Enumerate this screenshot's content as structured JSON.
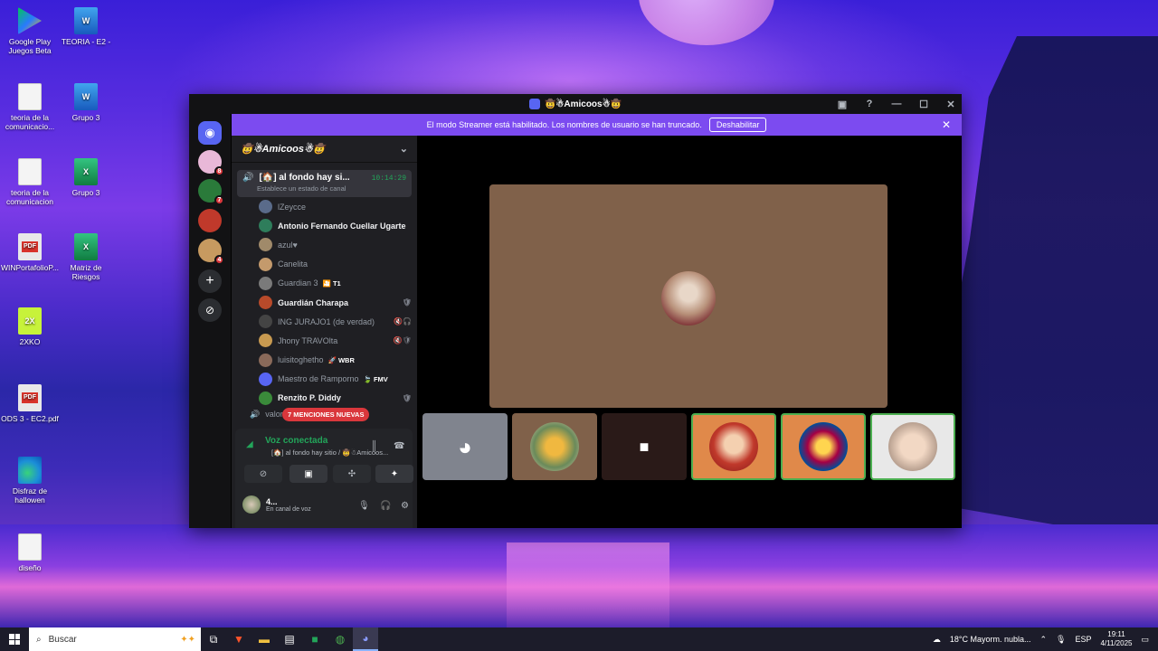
{
  "desktop": {
    "icons": [
      {
        "label": "Google Play Juegos Beta",
        "type": "play"
      },
      {
        "label": "TEORIA - E2 -",
        "type": "word"
      },
      {
        "label": "teoria de la comunicacio...",
        "type": "doc"
      },
      {
        "label": "Grupo 3",
        "type": "word"
      },
      {
        "label": "teoria de la comunicacion",
        "type": "doc"
      },
      {
        "label": "Grupo 3",
        "type": "excel"
      },
      {
        "label": "WINPortafolioP...",
        "type": "pdf"
      },
      {
        "label": "Matriz de Riesgos",
        "type": "excel"
      },
      {
        "label": "2XKO",
        "type": "2xko"
      },
      {
        "label": "ODS 3 - EC2.pdf",
        "type": "pdf"
      },
      {
        "label": "Disfraz de hallowen",
        "type": "edge"
      },
      {
        "label": "diseño",
        "type": "doc"
      }
    ]
  },
  "discord": {
    "window_title": "🤠☃Amicoos☃🤠",
    "banner_text": "El modo Streamer está habilitado. Los nombres de usuario se han truncado.",
    "banner_button": "Deshabilitar",
    "server_badges": [
      "8",
      "7",
      "",
      "4"
    ],
    "guild_name": "🤠☃Amicoos☃🤠",
    "voice_channel": {
      "name": "[🏠] al fondo hay si...",
      "time": "10:14:29",
      "status_placeholder": "Establece un estado de canal"
    },
    "members": [
      {
        "name": "lZeycce",
        "bright": false,
        "av": "#5a6b8a",
        "tag": "",
        "right": ""
      },
      {
        "name": "Antonio Fernando Cuellar Ugarte",
        "bright": true,
        "av": "#2e7d5b",
        "tag": "",
        "right": ""
      },
      {
        "name": "azul♥",
        "bright": false,
        "av": "#a08a6a",
        "tag": "",
        "right": ""
      },
      {
        "name": "Canelita",
        "bright": false,
        "av": "#c49a6c",
        "tag": "",
        "right": ""
      },
      {
        "name": "Guardian 3",
        "bright": false,
        "av": "#7a7a7a",
        "tag": "🎦 T1",
        "right": ""
      },
      {
        "name": "Guardián Charapa",
        "bright": true,
        "av": "#b84a2a",
        "tag": "",
        "right": "🛡"
      },
      {
        "name": "ING JURAJO1 (de verdad)",
        "bright": false,
        "av": "#444",
        "tag": "",
        "right": "🔇🎧"
      },
      {
        "name": "Jhony TRAVOlta",
        "bright": false,
        "av": "#c89a50",
        "tag": "",
        "right": "🔇🛡"
      },
      {
        "name": "luisitoghetho",
        "bright": false,
        "av": "#8a6a5a",
        "tag": "🚀 WBR",
        "right": ""
      },
      {
        "name": "Maestro de Ramporno",
        "bright": false,
        "av": "#5865f2",
        "tag": "🍃 FMV",
        "right": ""
      },
      {
        "name": "Renzito P. Diddy",
        "bright": true,
        "av": "#3a8a3a",
        "tag": "",
        "right": "🛡"
      }
    ],
    "mentions_pill": "7 MENCIONES NUEVAS",
    "next_channel": "valorant",
    "voice_panel": {
      "connected": "Voz conectada",
      "channel_path": "[🏠] al fondo hay sitio / 🤠☃Amicoos...",
      "user_name": "4...",
      "user_status": "En canal de voz"
    }
  },
  "taskbar": {
    "search_placeholder": "Buscar",
    "weather": "18°C  Mayorm. nubla...",
    "language": "ESP",
    "time": "19:11",
    "date": "4/11/2025"
  }
}
